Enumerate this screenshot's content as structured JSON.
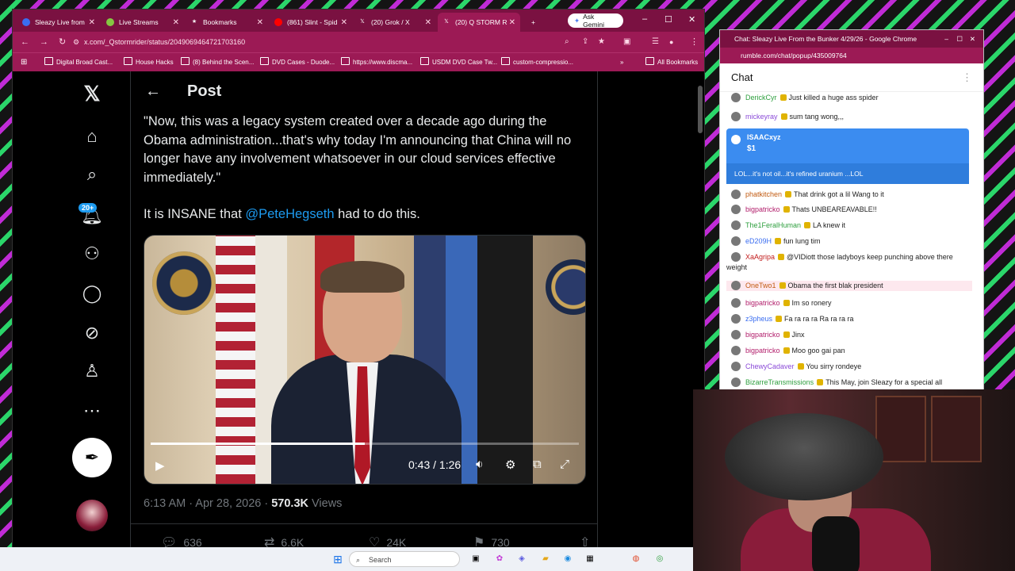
{
  "browser": {
    "tabs": [
      {
        "label": "Sleazy Live from",
        "icon": "rumble-icon",
        "icon_color": "#3a6df0",
        "active": false
      },
      {
        "label": "Live Streams",
        "icon": "rumble-play-icon",
        "icon_color": "#85c742",
        "active": false
      },
      {
        "label": "Bookmarks",
        "icon": "star-icon",
        "icon_color": "#ffffff",
        "active": false
      },
      {
        "label": "(861) Slint - Spid",
        "icon": "youtube-icon",
        "icon_color": "#ff0000",
        "active": false
      },
      {
        "label": "(20) Grok / X",
        "icon": "x-icon",
        "icon_color": "#ffffff",
        "active": false
      },
      {
        "label": "(20) Q STORM R",
        "icon": "x-icon",
        "icon_color": "#ffffff",
        "active": true
      }
    ],
    "gemini_label": "Ask Gemini",
    "url": "x.com/_Qstormrider/status/2049069464721703160",
    "bookmarks": [
      "Digital Broad Cast...",
      "House Hacks",
      "(8) Behind the Scen...",
      "DVD Cases - Duode...",
      "https://www.discma...",
      "USDM DVD Case Tw...",
      "custom-compressio..."
    ],
    "all_bookmarks": "All Bookmarks"
  },
  "x": {
    "header_title": "Post",
    "notif_count": "20+",
    "tweet_line1": "\"Now, this was a legacy system created over a decade ago during the Obama administration...that's why today I'm announcing that China will no longer have any involvement whatsoever in our cloud services effective immediately.\"",
    "tweet_line2_pre": "It is INSANE that ",
    "tweet_mention": "@PeteHegseth",
    "tweet_line2_post": " had to do this.",
    "video": {
      "time": "0:43 / 1:26",
      "progress": 0.5
    },
    "timestamp": "6:13 AM · Apr 28, 2026 · ",
    "views": "570.3K",
    "views_label": " Views",
    "replies": "636",
    "reposts": "6.6K",
    "likes": "24K",
    "bookmarks": "730"
  },
  "chat": {
    "window_title": "Chat: Sleazy Live From the Bunker 4/29/26 - Google Chrome",
    "url": "rumble.com/chat/popup/435009764",
    "header": "Chat",
    "rant": {
      "user": "ISAACxyz",
      "amount": "$1",
      "text": "LOL...it's not oil...it's refined uranium ...LOL"
    },
    "messages_top": [
      {
        "user": "DerickCyr",
        "text": "Just killed a huge ass spider",
        "color": "#2e9f3e"
      },
      {
        "user": "mickeyray",
        "text": "sum tang wong,,,",
        "color": "#8b4bd8"
      }
    ],
    "messages": [
      {
        "user": "phatkitchen",
        "text": "That drink got a lil Wang to it",
        "color": "#c25b12"
      },
      {
        "user": "bigpatricko",
        "text": "Thats UNBEAREAVABLE!!",
        "color": "#b21e6b"
      },
      {
        "user": "The1FeralHuman",
        "text": "LA knew it",
        "color": "#2e9f3e"
      },
      {
        "user": "eD209H",
        "text": "fun lung tim",
        "color": "#3a6df0"
      },
      {
        "user": "XaAgripa",
        "text": "@VIDiott those ladyboys keep punching above there weight",
        "color": "#c21e1e"
      },
      {
        "user": "OneTwo1",
        "text": "Obama the first blak president",
        "color": "#c25b12"
      },
      {
        "user": "bigpatricko",
        "text": "Im so ronery",
        "color": "#b21e6b"
      },
      {
        "user": "z3pheus",
        "text": "Fa ra ra ra Ra ra ra ra",
        "color": "#3a6df0"
      },
      {
        "user": "bigpatricko",
        "text": "Jinx",
        "color": "#b21e6b"
      },
      {
        "user": "bigpatricko",
        "text": "Moo goo gai pan",
        "color": "#b21e6b"
      },
      {
        "user": "ChewyCadaver",
        "text": "You sirry rondeye",
        "color": "#8b4bd8"
      },
      {
        "user": "BizarreTransmissions",
        "text": "This May, join Sleazy for a special all",
        "color": "#2e9f3e"
      }
    ]
  },
  "taskbar": {
    "search": "Search"
  }
}
